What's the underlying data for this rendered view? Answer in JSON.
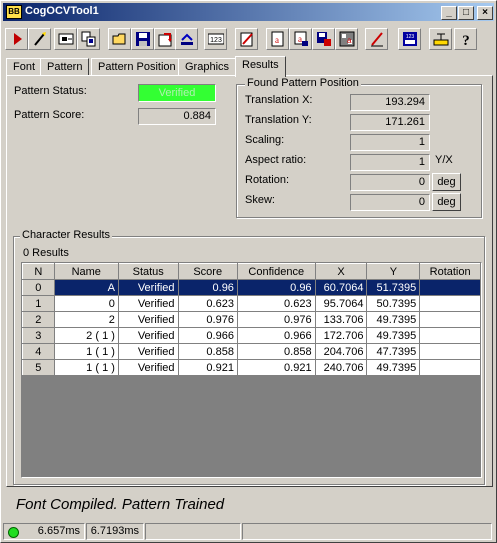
{
  "window": {
    "title": "CogOCVTool1",
    "app_icon_text": "BB"
  },
  "title_buttons": {
    "minimize": "_",
    "maximize": "□",
    "close": "×"
  },
  "toolbar": {
    "tools": [
      "run-icon",
      "wand-icon",
      "live-icon",
      "copy-icon",
      "open-icon",
      "save-icon",
      "reset-icon",
      "save-as-icon",
      "counter-icon",
      "edit-icon",
      "font-icon",
      "font-save-icon",
      "image-save-icon",
      "pen-icon",
      "grid-icon",
      "scale-icon",
      "help-icon"
    ],
    "counter_label": "123"
  },
  "tabs": [
    "Font",
    "Pattern",
    "Pattern Position",
    "Graphics",
    "Results"
  ],
  "active_tab": "Results",
  "pattern": {
    "status_label": "Pattern Status:",
    "status_value": "Verified",
    "score_label": "Pattern Score:",
    "score_value": "0.884"
  },
  "found_position": {
    "title": "Found Pattern Position",
    "translation_x_label": "Translation X:",
    "translation_x": "193.294",
    "translation_y_label": "Translation Y:",
    "translation_y": "171.261",
    "scaling_label": "Scaling:",
    "scaling": "1",
    "aspect_label": "Aspect ratio:",
    "aspect": "1",
    "aspect_unit": "Y/X",
    "rotation_label": "Rotation:",
    "rotation": "0",
    "skew_label": "Skew:",
    "skew": "0",
    "deg_label": "deg"
  },
  "character_results": {
    "title": "Character Results",
    "count_text": "0 Results",
    "columns": [
      "N",
      "Name",
      "Status",
      "Score",
      "Confidence",
      "X",
      "Y",
      "Rotation"
    ],
    "rows": [
      {
        "n": "0",
        "name": "A",
        "status": "Verified",
        "score": "0.96",
        "confidence": "0.96",
        "x": "60.7064",
        "y": "51.7395",
        "rotation": ""
      },
      {
        "n": "1",
        "name": "0",
        "status": "Verified",
        "score": "0.623",
        "confidence": "0.623",
        "x": "95.7064",
        "y": "50.7395",
        "rotation": ""
      },
      {
        "n": "2",
        "name": "2",
        "status": "Verified",
        "score": "0.976",
        "confidence": "0.976",
        "x": "133.706",
        "y": "49.7395",
        "rotation": ""
      },
      {
        "n": "3",
        "name": "2 ( 1 )",
        "status": "Verified",
        "score": "0.966",
        "confidence": "0.966",
        "x": "172.706",
        "y": "49.7395",
        "rotation": ""
      },
      {
        "n": "4",
        "name": "1 ( 1 )",
        "status": "Verified",
        "score": "0.858",
        "confidence": "0.858",
        "x": "204.706",
        "y": "47.7395",
        "rotation": ""
      },
      {
        "n": "5",
        "name": "1 ( 1 )",
        "status": "Verified",
        "score": "0.921",
        "confidence": "0.921",
        "x": "240.706",
        "y": "49.7395",
        "rotation": ""
      }
    ],
    "selected_row": 0
  },
  "status_message": "Font Compiled.  Pattern Trained",
  "statusbar": {
    "time1": "6.657ms",
    "time2": "6.7193ms",
    "led_color": "#22dd22"
  }
}
